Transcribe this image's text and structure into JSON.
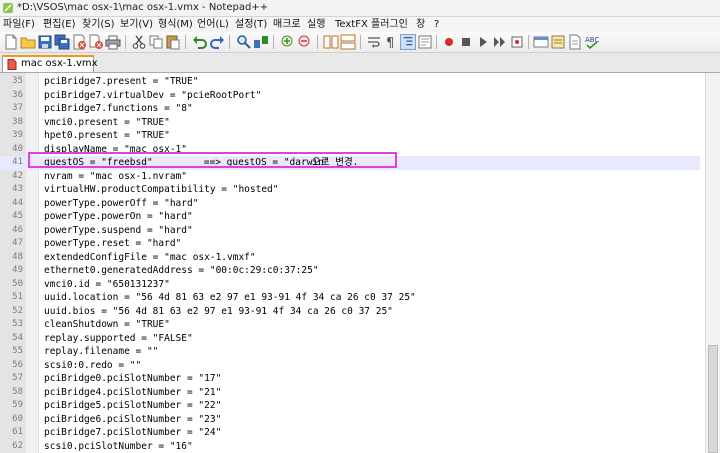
{
  "window": {
    "title": "*D:\\VSOS\\mac osx-1\\mac osx-1.vmx - Notepad++"
  },
  "menu": [
    "파일(F)",
    "편집(E)",
    "찾기(S)",
    "보기(V)",
    "형식(M)",
    "언어(L)",
    "설정(T)",
    "매크로",
    "실행",
    "TextFX",
    "플러그인",
    "창",
    "?"
  ],
  "tab": {
    "label": "mac osx-1.vmx",
    "icon": "document-icon"
  },
  "editor": {
    "lines": [
      {
        "n": "35",
        "text": "pciBridge7.present = \"TRUE\""
      },
      {
        "n": "36",
        "text": "pciBridge7.virtualDev = \"pcieRootPort\""
      },
      {
        "n": "37",
        "text": "pciBridge7.functions = \"8\""
      },
      {
        "n": "38",
        "text": "vmci0.present = \"TRUE\""
      },
      {
        "n": "39",
        "text": "hpet0.present = \"TRUE\""
      },
      {
        "n": "40",
        "text": "displayName = \"mac osx-1\""
      },
      {
        "n": "41",
        "text": "guestOS = \"freebsd\""
      },
      {
        "n": "42",
        "text": "nvram = \"mac osx-1.nvram\""
      },
      {
        "n": "43",
        "text": "virtualHW.productCompatibility = \"hosted\""
      },
      {
        "n": "44",
        "text": "powerType.powerOff = \"hard\""
      },
      {
        "n": "45",
        "text": "powerType.powerOn = \"hard\""
      },
      {
        "n": "46",
        "text": "powerType.suspend = \"hard\""
      },
      {
        "n": "47",
        "text": "powerType.reset = \"hard\""
      },
      {
        "n": "48",
        "text": "extendedConfigFile = \"mac osx-1.vmxf\""
      },
      {
        "n": "49",
        "text": "ethernet0.generatedAddress = \"00:0c:29:c0:37:25\""
      },
      {
        "n": "50",
        "text": "vmci0.id = \"650131237\""
      },
      {
        "n": "51",
        "text": "uuid.location = \"56 4d 81 63 e2 97 e1 93-91 4f 34 ca 26 c0 37 25\""
      },
      {
        "n": "52",
        "text": "uuid.bios = \"56 4d 81 63 e2 97 e1 93-91 4f 34 ca 26 c0 37 25\""
      },
      {
        "n": "53",
        "text": "cleanShutdown = \"TRUE\""
      },
      {
        "n": "54",
        "text": "replay.supported = \"FALSE\""
      },
      {
        "n": "55",
        "text": "replay.filename = \"\""
      },
      {
        "n": "56",
        "text": "scsi0:0.redo = \"\""
      },
      {
        "n": "57",
        "text": "pciBridge0.pciSlotNumber = \"17\""
      },
      {
        "n": "58",
        "text": "pciBridge4.pciSlotNumber = \"21\""
      },
      {
        "n": "59",
        "text": "pciBridge5.pciSlotNumber = \"22\""
      },
      {
        "n": "60",
        "text": "pciBridge6.pciSlotNumber = \"23\""
      },
      {
        "n": "61",
        "text": "pciBridge7.pciSlotNumber = \"24\""
      },
      {
        "n": "62",
        "text": "scsi0.pciSlotNumber = \"16\""
      }
    ],
    "current_line": "41",
    "annotation": {
      "code_part": "        ==> guestOS = \"darwin\"",
      "korean_note": "으로 변경."
    }
  },
  "colors": {
    "highlight_box": "#e040e0",
    "current_line_bg": "#e8e8ff",
    "tab_accent": "#f09a1c"
  },
  "toolbar_icons": [
    "new-file-icon",
    "open-folder-icon",
    "save-icon",
    "save-all-icon",
    "close-icon",
    "close-all-icon",
    "print-icon",
    "cut-icon",
    "copy-icon",
    "paste-icon",
    "undo-icon",
    "redo-icon",
    "find-icon",
    "replace-icon",
    "zoom-in-icon",
    "zoom-out-icon",
    "sync-vertical-icon",
    "sync-horizontal-icon",
    "word-wrap-icon",
    "show-all-chars-icon",
    "indent-guide-icon",
    "record-macro-icon",
    "stop-macro-icon",
    "play-macro-icon",
    "run-macro-multiple-icon",
    "save-macro-icon",
    "open-in-browser-icon",
    "document-map-icon",
    "spellcheck-icon"
  ]
}
